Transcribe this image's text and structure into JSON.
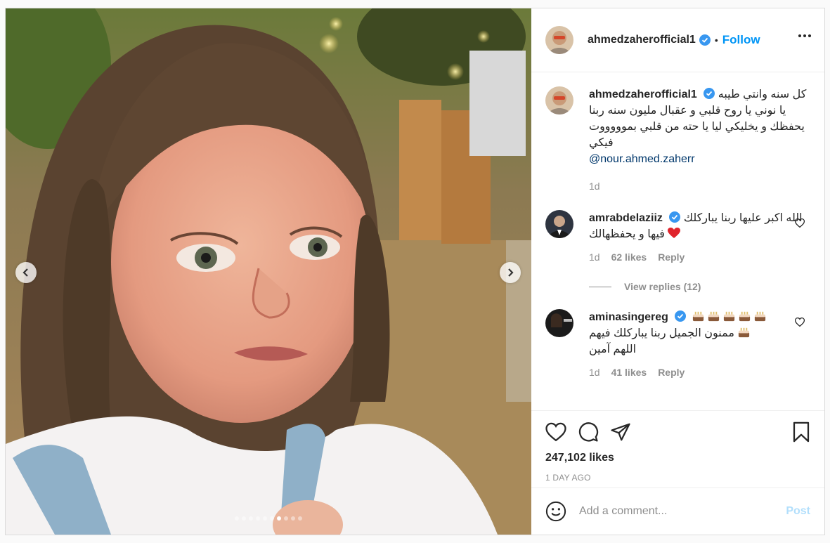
{
  "post": {
    "author": "ahmedzaherofficial1",
    "follow_label": "Follow",
    "separator": "•",
    "caption": "كل سنه وانتي طيبه يا نوني يا روح قلبي و عقبال مليون سنه ربنا يحفظك و يخليكي ليا يا حته من قلبي بموووووت فيكي",
    "mention": "@nour.ahmed.zaherr",
    "caption_age": "1d",
    "likes": "247,102 likes",
    "date": "1 DAY AGO",
    "carousel": {
      "count": 10,
      "active_index": 6
    }
  },
  "comments": [
    {
      "user": "amrabdelaziiz",
      "text": "الله اكبر عليها ربنا يباركلك فيها و يحفظهالك",
      "emoji": "red-heart",
      "age": "1d",
      "likes": "62 likes",
      "reply_label": "Reply"
    },
    {
      "user": "aminasingereg",
      "text": "ممنون الجميل ربنا يباركلك فيهم",
      "text2": "اللهم آمين",
      "emoji": "birthday-cake",
      "age": "1d",
      "likes": "41 likes",
      "reply_label": "Reply"
    }
  ],
  "view_replies": "View replies (12)",
  "add_comment": {
    "placeholder": "Add a comment...",
    "post_label": "Post"
  },
  "colors": {
    "accent": "#0095f6",
    "post_disabled": "#b2dffc",
    "mention": "#00376b",
    "muted": "#8e8e8e",
    "heart": "#ed4956"
  }
}
